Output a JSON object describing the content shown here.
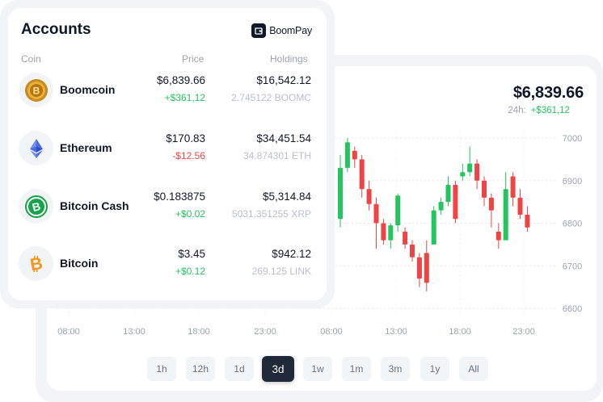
{
  "accounts": {
    "title": "Accounts",
    "brand": "BoomPay",
    "columns": {
      "coin": "Coin",
      "price": "Price",
      "holdings": "Holdings"
    },
    "rows": [
      {
        "name": "Boomcoin",
        "icon": "boomcoin-icon",
        "price": "$6,839.66",
        "change": "+$361,12",
        "holding": "$16,542.12",
        "quantity": "2.745122 BOOMC"
      },
      {
        "name": "Ethereum",
        "icon": "ethereum-icon",
        "price": "$170.83",
        "change": "-$12.56",
        "holding": "$34,451.54",
        "quantity": "34.874301 ETH"
      },
      {
        "name": "Bitcoin Cash",
        "icon": "bitcoin-cash-icon",
        "price": "$0.183875",
        "change": "+$0.02",
        "holding": "$5,314.84",
        "quantity": "5031.351255 XRP"
      },
      {
        "name": "Bitcoin",
        "icon": "bitcoin-icon",
        "price": "$3.45",
        "change": "+$0.12",
        "holding": "$942.12",
        "quantity": "269.125 LINK"
      }
    ]
  },
  "chart": {
    "price": "$6,839.66",
    "change_label": "24h:",
    "change_value": "+$361,12",
    "timeframes": [
      "1h",
      "12h",
      "1d",
      "3d",
      "1w",
      "1m",
      "3m",
      "1y",
      "All"
    ],
    "active_timeframe": "3d"
  },
  "colors": {
    "up": "#22c55e",
    "down": "#ef4444",
    "active_tab": "#1f2937",
    "muted": "#9ca3af"
  },
  "chart_data": {
    "type": "candlestick",
    "x_tick_labels": [
      "08:00",
      "13:00",
      "18:00",
      "23:00",
      "08:00",
      "13:00",
      "18:00",
      "23:00"
    ],
    "y_tick_labels": [
      "7000",
      "6900",
      "6800",
      "6700",
      "6600"
    ],
    "ylim": [
      6600,
      7000
    ],
    "grid": true,
    "candles": [
      {
        "o": 6810,
        "c": 6930,
        "h": 6960,
        "l": 6790
      },
      {
        "o": 6930,
        "c": 6990,
        "h": 7000,
        "l": 6920
      },
      {
        "o": 6970,
        "c": 6950,
        "h": 6980,
        "l": 6930
      },
      {
        "o": 6950,
        "c": 6880,
        "h": 6960,
        "l": 6860
      },
      {
        "o": 6880,
        "c": 6845,
        "h": 6900,
        "l": 6830
      },
      {
        "o": 6845,
        "c": 6800,
        "h": 6860,
        "l": 6740
      },
      {
        "o": 6800,
        "c": 6760,
        "h": 6810,
        "l": 6750
      },
      {
        "o": 6760,
        "c": 6795,
        "h": 6800,
        "l": 6740
      },
      {
        "o": 6795,
        "c": 6865,
        "h": 6870,
        "l": 6780
      },
      {
        "o": 6780,
        "c": 6750,
        "h": 6790,
        "l": 6740
      },
      {
        "o": 6750,
        "c": 6720,
        "h": 6760,
        "l": 6710
      },
      {
        "o": 6720,
        "c": 6670,
        "h": 6730,
        "l": 6650
      },
      {
        "o": 6730,
        "c": 6660,
        "h": 6760,
        "l": 6640
      },
      {
        "o": 6750,
        "c": 6830,
        "h": 6840,
        "l": 6750
      },
      {
        "o": 6830,
        "c": 6850,
        "h": 6860,
        "l": 6820
      },
      {
        "o": 6850,
        "c": 6890,
        "h": 6910,
        "l": 6840
      },
      {
        "o": 6890,
        "c": 6810,
        "h": 6900,
        "l": 6800
      },
      {
        "o": 6910,
        "c": 6920,
        "h": 6940,
        "l": 6900
      },
      {
        "o": 6920,
        "c": 6940,
        "h": 6980,
        "l": 6910
      },
      {
        "o": 6940,
        "c": 6900,
        "h": 6950,
        "l": 6880
      },
      {
        "o": 6900,
        "c": 6860,
        "h": 6910,
        "l": 6840
      },
      {
        "o": 6860,
        "c": 6830,
        "h": 6870,
        "l": 6790
      },
      {
        "o": 6780,
        "c": 6760,
        "h": 6800,
        "l": 6740
      },
      {
        "o": 6760,
        "c": 6880,
        "h": 6920,
        "l": 6760
      },
      {
        "o": 6910,
        "c": 6860,
        "h": 6920,
        "l": 6840
      },
      {
        "o": 6860,
        "c": 6820,
        "h": 6880,
        "l": 6810
      },
      {
        "o": 6820,
        "c": 6790,
        "h": 6840,
        "l": 6780
      }
    ]
  }
}
